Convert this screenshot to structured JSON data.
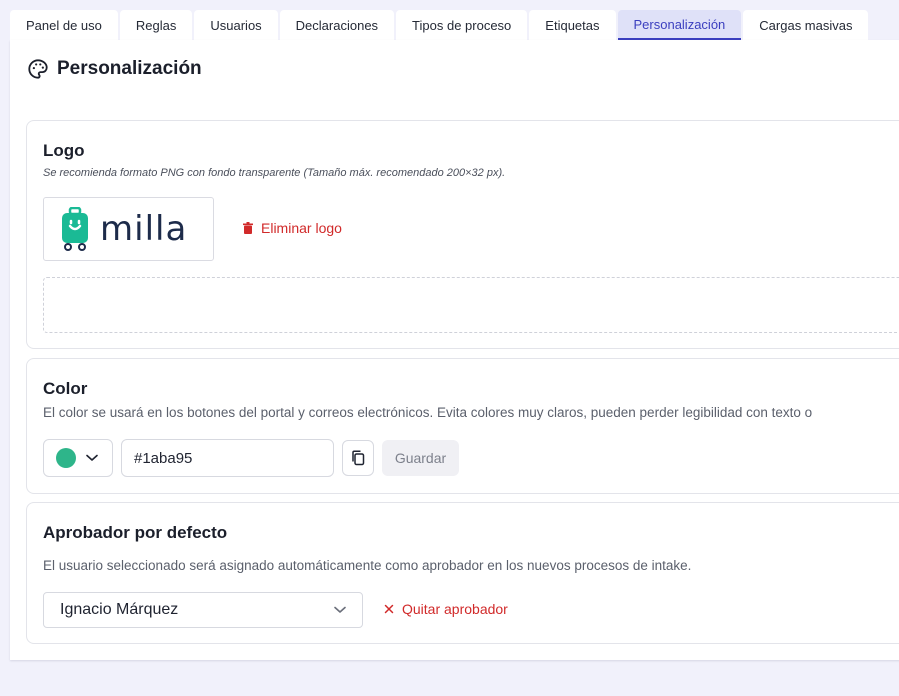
{
  "tabs": [
    {
      "label": "Panel de uso"
    },
    {
      "label": "Reglas"
    },
    {
      "label": "Usuarios"
    },
    {
      "label": "Declaraciones"
    },
    {
      "label": "Tipos de proceso"
    },
    {
      "label": "Etiquetas"
    },
    {
      "label": "Personalización",
      "active": true
    },
    {
      "label": "Cargas masivas"
    }
  ],
  "page": {
    "title": "Personalización",
    "icon": "palette-icon"
  },
  "logo_section": {
    "title": "Logo",
    "description": "Se recomienda formato PNG con fondo transparente (Tamaño máx. recomendado 200×32 px).",
    "logo_text": "milla",
    "logo_color": "#1aba95",
    "remove_label": "Eliminar logo"
  },
  "color_section": {
    "title": "Color",
    "description": "El color se usará en los botones del portal y correos electrónicos. Evita colores muy claros, pueden perder legibilidad con texto o",
    "hex_value": "#1aba95",
    "swatch_color": "#2eb58a",
    "save_label": "Guardar"
  },
  "approver_section": {
    "title": "Aprobador por defecto",
    "description": "El usuario seleccionado será asignado automáticamente como aprobador en los nuevos procesos de intake.",
    "selected_user": "Ignacio Márquez",
    "remove_label": "Quitar aprobador"
  },
  "colors": {
    "accent": "#3b3fbf",
    "danger": "#d12a2a",
    "brand": "#1aba95"
  }
}
